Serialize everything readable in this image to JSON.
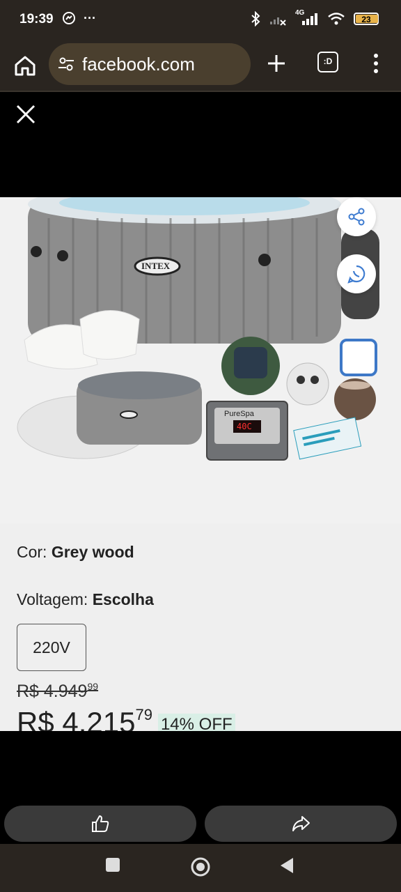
{
  "status_bar": {
    "time": "19:39",
    "network": "4G",
    "battery": "23",
    "battery_color": "#e8b34a"
  },
  "browser": {
    "url": "facebook.com",
    "tabs_label": ":D",
    "icons": [
      "home-icon",
      "tune-icon",
      "plus-icon",
      "tabs-icon",
      "more-vert-icon"
    ]
  },
  "viewer": {
    "icons": [
      "close-icon",
      "share-icon",
      "whatsapp-icon",
      "like-icon",
      "forward-icon"
    ]
  },
  "product": {
    "color_label": "Cor: ",
    "color_value": "Grey wood",
    "voltage_label": "Voltagem: ",
    "voltage_value": "Escolha",
    "voltage_option": "220V",
    "old_price_main": "R$ 4.949",
    "old_price_cents": "99",
    "new_price_main": "R$ 4.215",
    "new_price_cents": "79",
    "discount": "14% OFF",
    "brand_on_image": "INTEX",
    "panel_brand": "PureSpa",
    "panel_display": "40C",
    "discount_bg": "#d9efe6"
  },
  "nav": {
    "icons": [
      "recents-square-icon",
      "home-circle-icon",
      "back-triangle-icon"
    ]
  }
}
